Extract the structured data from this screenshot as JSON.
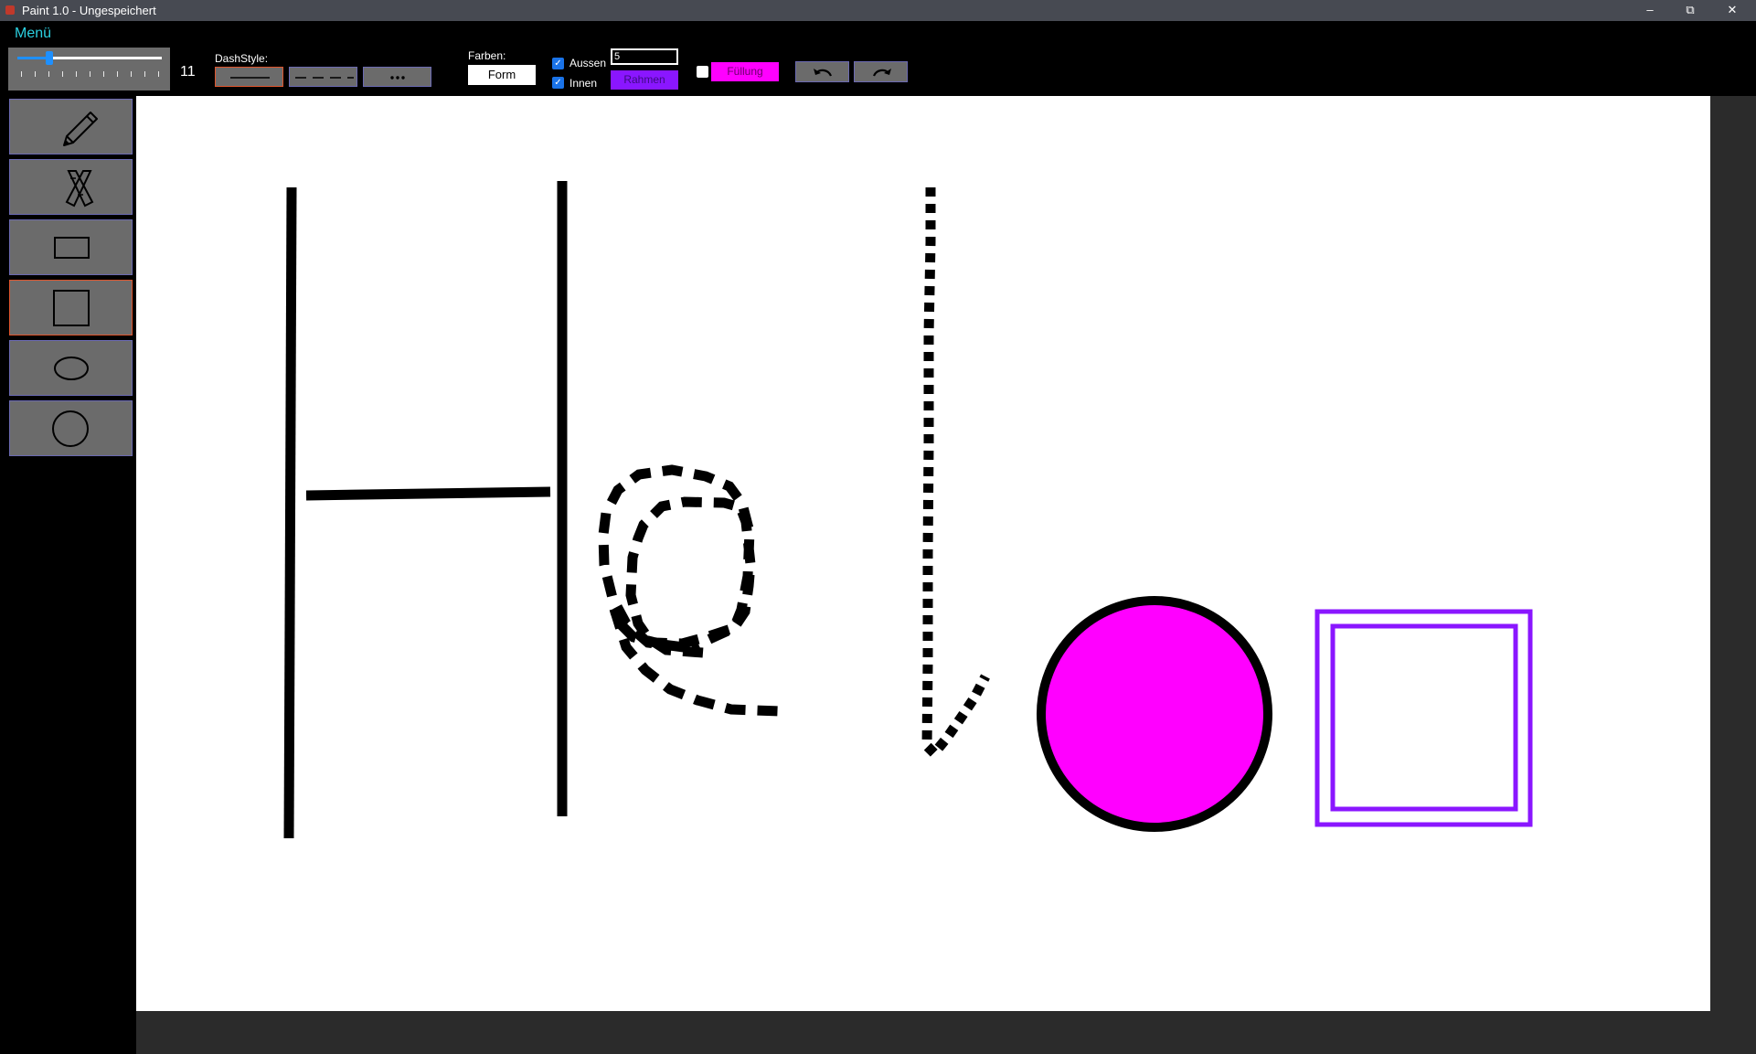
{
  "window": {
    "title": "Paint 1.0 - Ungespeichert",
    "controls": {
      "minimize": "–",
      "maximize": "⧉",
      "close": "✕"
    }
  },
  "menu": {
    "label": "Menü"
  },
  "toolbar": {
    "thickness": {
      "value": "11",
      "fraction": 0.22
    },
    "dash_style_label": "DashStyle:",
    "dash_styles": [
      "solid",
      "dash",
      "dot"
    ],
    "selected_dash_style": "solid",
    "colors_label": "Farben:",
    "form_button": "Form",
    "outer_label": "Aussen",
    "outer_checked": true,
    "inner_label": "Innen",
    "inner_checked": true,
    "border_width_value": "5",
    "frame_button": "Rahmen",
    "frame_color": "#8a16ff",
    "fill_checked": false,
    "fill_button": "Füllung",
    "fill_color": "#ff00ff",
    "undo_icon": "undo-icon",
    "redo_icon": "redo-icon"
  },
  "tools": [
    {
      "name": "pencil",
      "icon": "pencil-icon"
    },
    {
      "name": "eraser",
      "icon": "eraser-icon"
    },
    {
      "name": "rectangle",
      "icon": "rectangle-icon"
    },
    {
      "name": "square",
      "icon": "square-icon",
      "selected": true
    },
    {
      "name": "ellipse",
      "icon": "ellipse-icon"
    },
    {
      "name": "circle",
      "icon": "circle-icon"
    }
  ],
  "canvas": {
    "background": "#ffffff",
    "shapes": [
      "H solid",
      "e dashed",
      "l dotted",
      "magenta circle",
      "purple double square"
    ]
  }
}
